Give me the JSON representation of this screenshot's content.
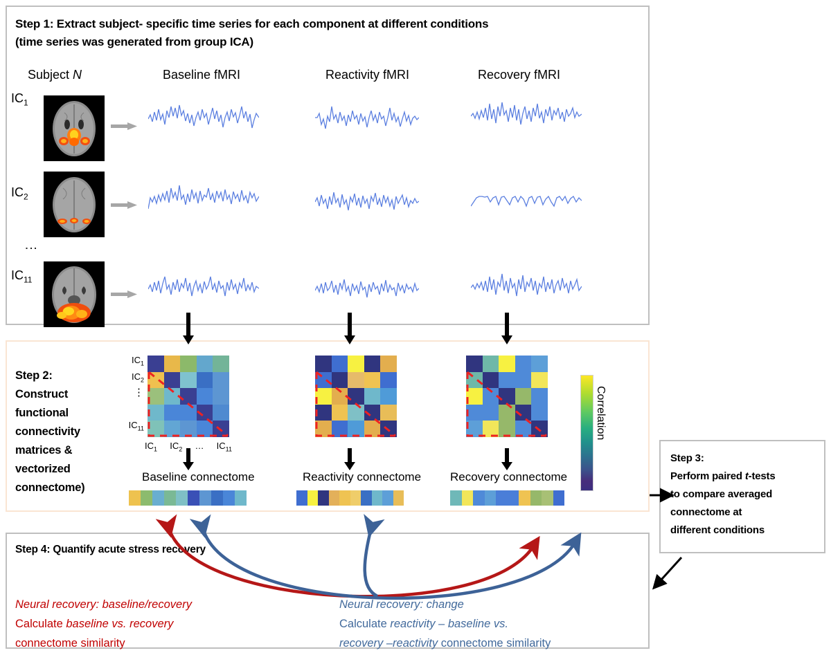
{
  "step1": {
    "title_line1": "Step 1: Extract subject- specific time series for each component at different conditions",
    "title_line2": "(time series was generated from group ICA)",
    "columns": [
      "Subject N",
      "Baseline fMRI",
      "Reactivity fMRI",
      "Recovery fMRI"
    ],
    "row_labels": [
      "IC1",
      "IC2",
      "IC11"
    ],
    "row_label_parts": [
      {
        "base": "IC",
        "sub": "1"
      },
      {
        "base": "IC",
        "sub": "2"
      },
      {
        "base": "IC",
        "sub": "11"
      }
    ],
    "vertical_ellipsis": "⋮"
  },
  "step2": {
    "title": "Step 2: Construct functional connectivity matrices & vectorized connectome)",
    "title_lines": [
      "Step 2:",
      "Construct",
      "functional",
      "connectivity",
      "matrices &",
      "vectorized",
      "connectome)"
    ],
    "matrix_row_labels": [
      "IC1",
      "IC2",
      "⋮",
      "",
      "IC11"
    ],
    "matrix_col_labels": [
      "IC1",
      "IC2",
      "…",
      "IC11"
    ],
    "colorbar_label": "Correlation",
    "connectome_titles": [
      "Baseline connectome",
      "Reactivity connectome",
      "Recovery connectome"
    ]
  },
  "step3": {
    "title": "Step 3:",
    "lines": [
      "Step 3:",
      "Perform paired t-tests",
      "to compare averaged",
      "connectome at",
      "different conditions"
    ],
    "body_pre": "Perform paired ",
    "body_italic": "t",
    "body_post": "-tests to compare averaged connectome at different conditions"
  },
  "step4": {
    "title": "Step 4: Quantify acute stress recovery",
    "left": {
      "color": "#c00000",
      "line1": "Neural recovery: baseline/recovery",
      "line2_pre": "Calculate ",
      "line2_italic": "baseline vs. recovery",
      "line3": "connectome similarity"
    },
    "right": {
      "color": "#41699b",
      "line1": "Neural recovery: change",
      "line2_pre": "Calculate ",
      "line2_italic": "reactivity – baseline vs.",
      "line3_italic": "recovery –reactivity",
      "line3_post": " connectome similarity"
    }
  },
  "colors": {
    "timeseries": "#5b7fe0",
    "gray_arrow": "#a6a6a6",
    "black_arrow": "#000000",
    "red_arrow": "#b51717",
    "blue_arrow": "#3d6297",
    "dashed_red": "#ee2222",
    "step1_border": "#bfbfbf",
    "step2_border": "#fae5d3",
    "step3_border": "#bfbfbf",
    "step4_border": "#bfbfbf"
  },
  "chart_data": {
    "type": "heatmap",
    "title": "Functional connectivity matrices (11 ICs, shown as 5x5 schematic)",
    "colormap": "viridis",
    "colorbar_label": "Correlation",
    "axis_labels": {
      "x": [
        "IC1",
        "IC2",
        "…",
        "IC11"
      ],
      "y": [
        "IC1",
        "IC2",
        "⋮",
        "",
        "IC11"
      ]
    },
    "matrices": [
      {
        "name": "Baseline fMRI",
        "grid": [
          [
            "#3a3f92",
            "#e8b84a",
            "#8cb96a",
            "#63a7cd",
            "#73b498"
          ],
          [
            "#efc04f",
            "#3a3f92",
            "#7fc2cf",
            "#3a6fc4",
            "#5d96d2"
          ],
          [
            "#9bc07c",
            "#6fb8cb",
            "#3a3f92",
            "#4a86d8",
            "#5d96d2"
          ],
          [
            "#6fb8cb",
            "#4a86d8",
            "#4a86d8",
            "#3a3f92",
            "#4f8ad0"
          ],
          [
            "#7fc2b8",
            "#62a6d4",
            "#5d96d2",
            "#4a86d8",
            "#3a3f92"
          ]
        ]
      },
      {
        "name": "Reactivity fMRI",
        "grid": [
          [
            "#30357f",
            "#3f6ed0",
            "#f7f141",
            "#30357f",
            "#e3ae4e"
          ],
          [
            "#3f6ed0",
            "#30357f",
            "#e6bb6a",
            "#efc352",
            "#3f6ed0"
          ],
          [
            "#f7f141",
            "#e3ae4e",
            "#30357f",
            "#6fb8cb",
            "#4f9bd8"
          ],
          [
            "#30357f",
            "#efc352",
            "#7fc0c6",
            "#30357f",
            "#e8bd58"
          ],
          [
            "#e3ae4e",
            "#3f6ed0",
            "#4f9bd8",
            "#e3ae4e",
            "#30357f"
          ]
        ]
      },
      {
        "name": "Recovery fMRI",
        "grid": [
          [
            "#30357f",
            "#6fb8a8",
            "#f7f141",
            "#4f8ad8",
            "#5d9fd8"
          ],
          [
            "#6fb8a8",
            "#30357f",
            "#4f8ad8",
            "#4f8ad8",
            "#f2e65a"
          ],
          [
            "#f7f141",
            "#4f8ad8",
            "#30357f",
            "#96b86a",
            "#4f8ad8"
          ],
          [
            "#4f8ad8",
            "#4f8ad8",
            "#96b86a",
            "#30357f",
            "#4f8ad8"
          ],
          [
            "#5d9fd8",
            "#f2e65a",
            "#96b86a",
            "#4f8ad8",
            "#30357f"
          ]
        ]
      }
    ],
    "connectome_vectors": [
      {
        "name": "Baseline connectome",
        "colors": [
          "#eec24f",
          "#8cbb6e",
          "#69aed0",
          "#7ab995",
          "#7fc0c6",
          "#3a50b6",
          "#5d96d2",
          "#3a6fc4",
          "#4a86d8",
          "#6fb8cb"
        ]
      },
      {
        "name": "Reactivity connectome",
        "colors": [
          "#3f6ed0",
          "#f7f141",
          "#30357f",
          "#e3b05a",
          "#efc352",
          "#efcd6a",
          "#3a6fc4",
          "#6fb8cb",
          "#5d9fd8",
          "#e8bd58"
        ]
      },
      {
        "name": "Recovery connectome",
        "colors": [
          "#6fb8b8",
          "#f2e65a",
          "#4f8ad8",
          "#5d9fd8",
          "#4a7ed8",
          "#4a7ed8",
          "#efc352",
          "#96b86a",
          "#a8c075",
          "#3f6ed0"
        ]
      }
    ]
  }
}
